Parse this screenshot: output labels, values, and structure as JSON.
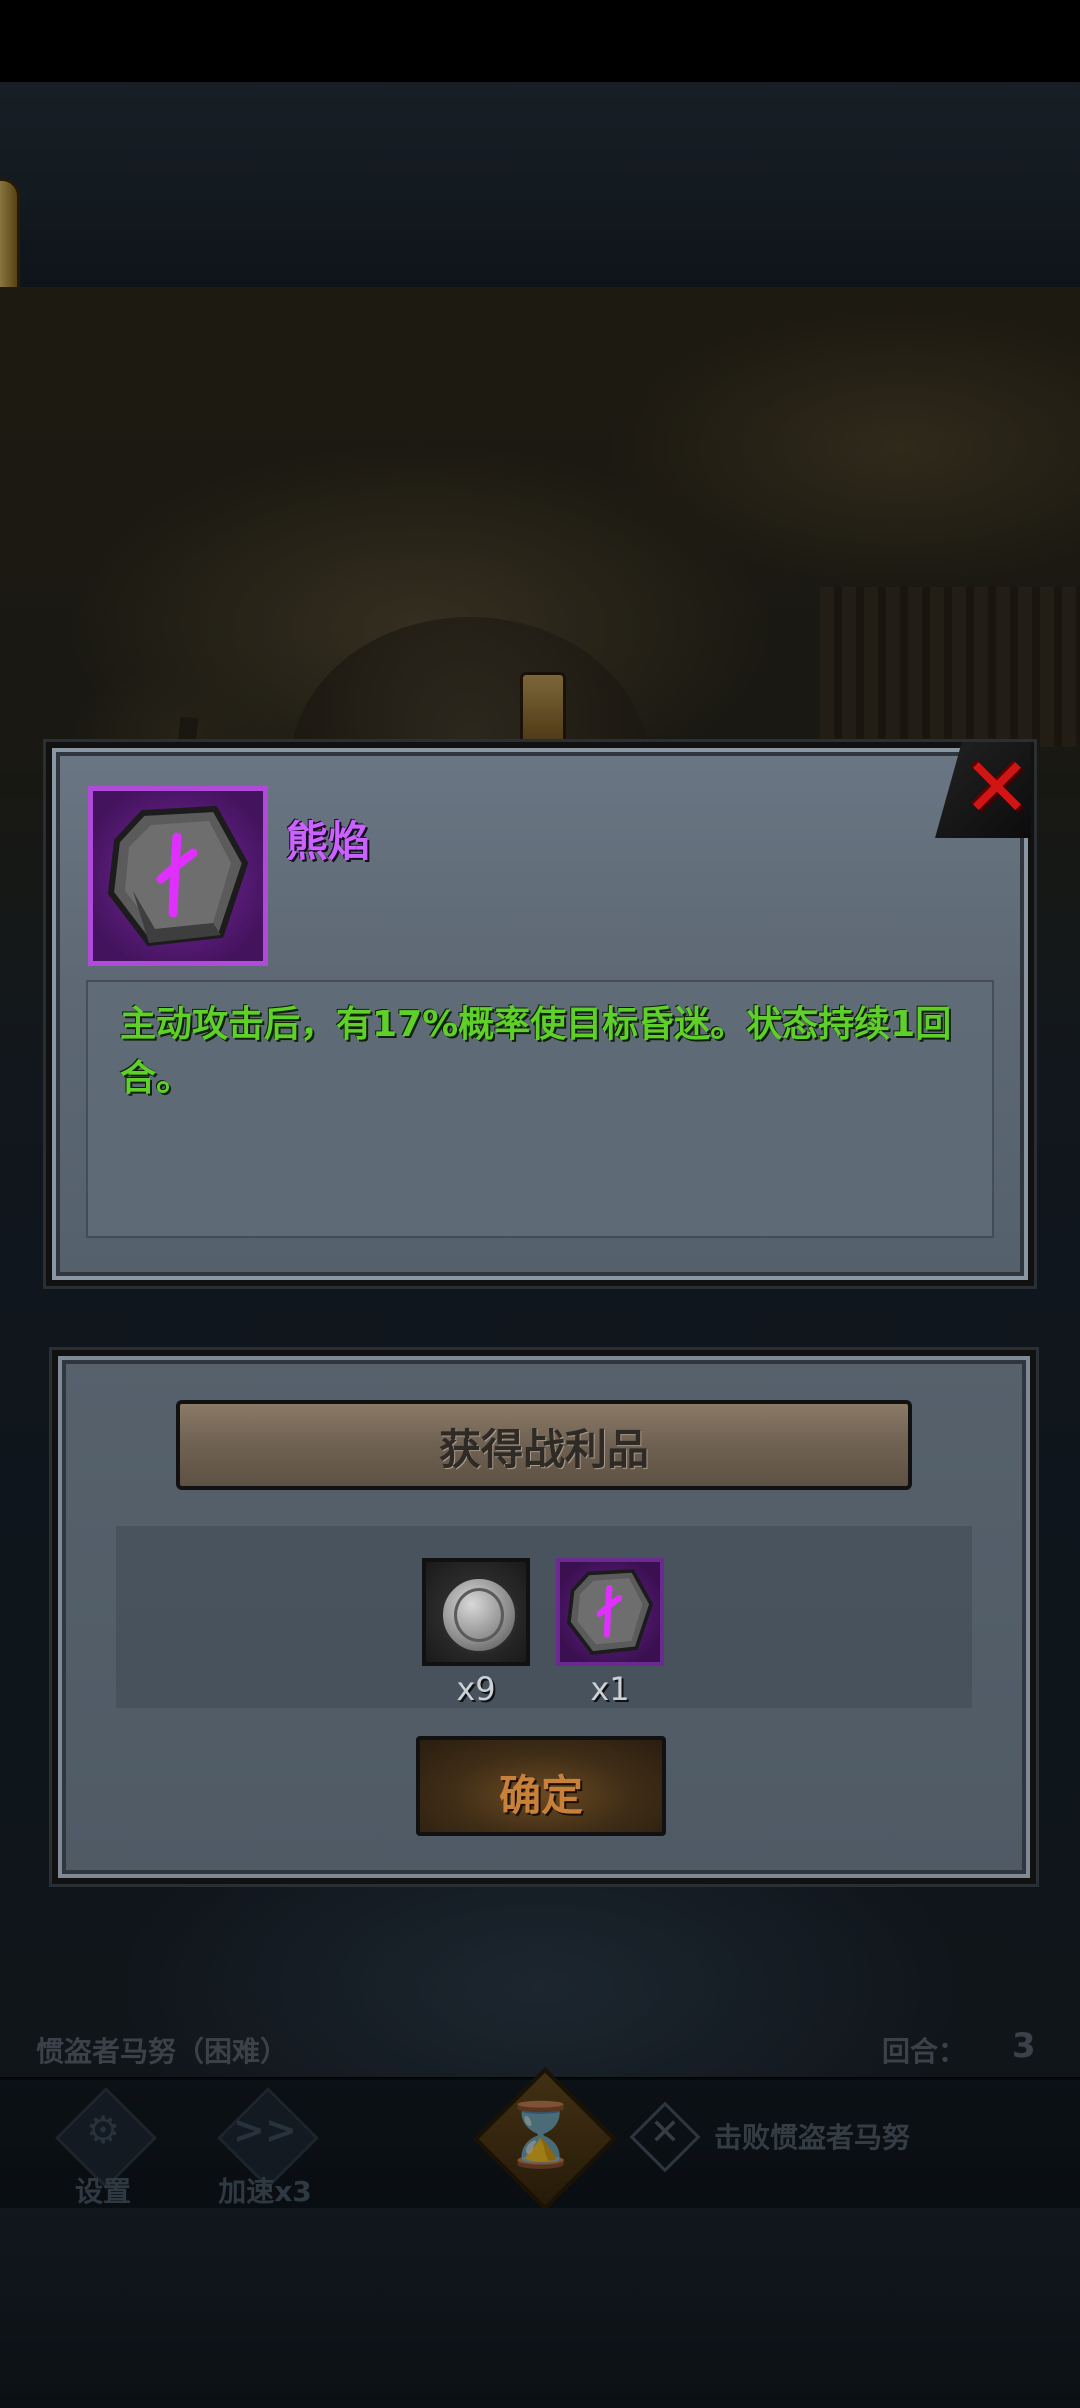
{
  "rune_popup": {
    "name": "熊焰",
    "description": "主动攻击后，有17%概率使目标昏迷。状态持续1回合。",
    "close_symbol": "✕",
    "colors": {
      "name": "#c962ff",
      "description": "#5fd02a",
      "close": "#d11414",
      "rune_frame": "#b04ad8"
    },
    "icon": "purple-rune-stone-icon"
  },
  "reward_popup": {
    "title": "获得战利品",
    "items": [
      {
        "icon": "silver-coin-icon",
        "count": "x9"
      },
      {
        "icon": "purple-rune-stone-icon",
        "count": "x1"
      }
    ],
    "confirm_label": "确定"
  },
  "hud": {
    "stage_name": "惯盗者马努（困难）",
    "round_label": "回合：",
    "round_value": "3",
    "settings_label": "设置",
    "settings_icon": "gear-icon",
    "speed_label": "加速x3",
    "speed_icon": "fast-forward-icon",
    "speed_glyph": ">>",
    "end_turn_icon": "hourglass-icon",
    "end_turn_glyph": "⌛",
    "objective_text": "击败惯盗者马努",
    "objective_icon": "crossed-swords-icon",
    "objective_glyph": "✕"
  }
}
